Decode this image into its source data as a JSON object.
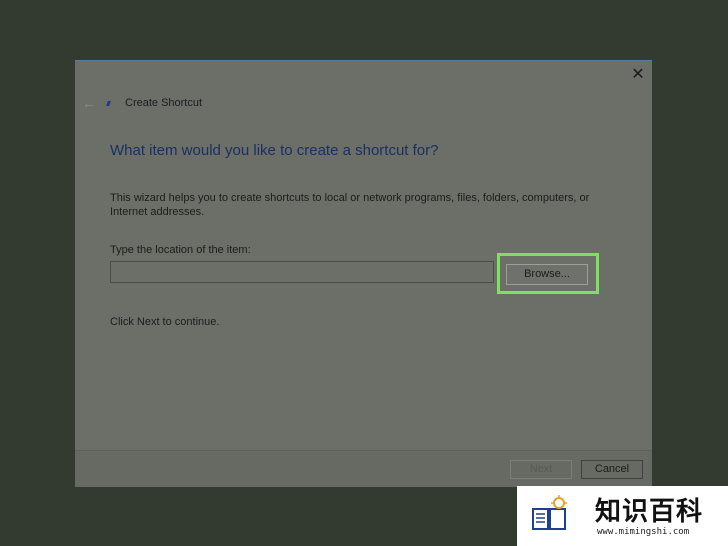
{
  "dialog": {
    "title": "Create Shortcut",
    "heading": "What item would you like to create a shortcut for?",
    "description": "This wizard helps you to create shortcuts to local or network programs, files, folders, computers, or Internet addresses.",
    "location_label": "Type the location of the item:",
    "location_value": "",
    "browse_label": "Browse...",
    "continue_text": "Click Next to continue.",
    "close_glyph": "✕",
    "back_glyph": "←"
  },
  "footer": {
    "next_label": "Next",
    "cancel_label": "Cancel"
  },
  "watermark": {
    "title": "知识百科",
    "url": "www.mimingshi.com"
  },
  "colors": {
    "highlight": "#7ee05e",
    "heading": "#1b2f63",
    "backdrop": "#333a2f"
  }
}
